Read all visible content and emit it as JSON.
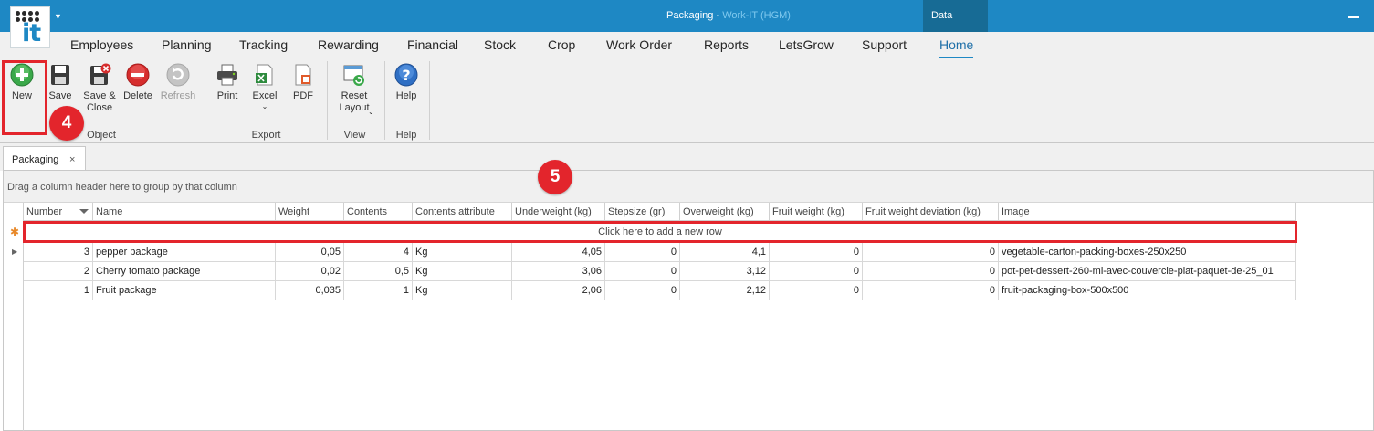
{
  "window": {
    "title": "Packaging",
    "app_name": "Work-IT (HGM)",
    "context_tab": "Data"
  },
  "menu": [
    "Employees",
    "Planning",
    "Tracking",
    "Rewarding",
    "Financial",
    "Stock",
    "Crop",
    "Work Order",
    "Reports",
    "LetsGrow",
    "Support",
    "Home"
  ],
  "ribbon": {
    "new": "New",
    "save": "Save",
    "save_close": "Save & Close",
    "delete": "Delete",
    "refresh": "Refresh",
    "print": "Print",
    "excel": "Excel",
    "pdf": "PDF",
    "reset_layout": "Reset Layout",
    "help": "Help",
    "groups": {
      "object": "Object",
      "export": "Export",
      "view": "View",
      "help": "Help"
    }
  },
  "annotations": {
    "badge_4": "4",
    "badge_5": "5"
  },
  "doc_tab": {
    "label": "Packaging",
    "close": "×"
  },
  "grid": {
    "group_panel_hint": "Drag a column header here to group by that column",
    "new_row_text": "Click here to add a new row",
    "columns": [
      "Number",
      "Name",
      "Weight",
      "Contents",
      "Contents attribute",
      "Underweight (kg)",
      "Stepsize (gr)",
      "Overweight (kg)",
      "Fruit weight  (kg)",
      "Fruit weight deviation  (kg)",
      "Image"
    ],
    "rows": [
      [
        "3",
        "pepper package",
        "0,05",
        "4",
        "Kg",
        "4,05",
        "0",
        "4,1",
        "0",
        "0",
        "vegetable-carton-packing-boxes-250x250"
      ],
      [
        "2",
        "Cherry tomato package",
        "0,02",
        "0,5",
        "Kg",
        "3,06",
        "0",
        "3,12",
        "0",
        "0",
        "pot-pet-dessert-260-ml-avec-couvercle-plat-paquet-de-25_01"
      ],
      [
        "1",
        "Fruit package",
        "0,035",
        "1",
        "Kg",
        "2,06",
        "0",
        "2,12",
        "0",
        "0",
        "fruit-packaging-box-500x500"
      ]
    ]
  },
  "colors": {
    "title_bar": "#1e88c4",
    "highlight": "#e3252c",
    "data_tab": "#176b95"
  }
}
